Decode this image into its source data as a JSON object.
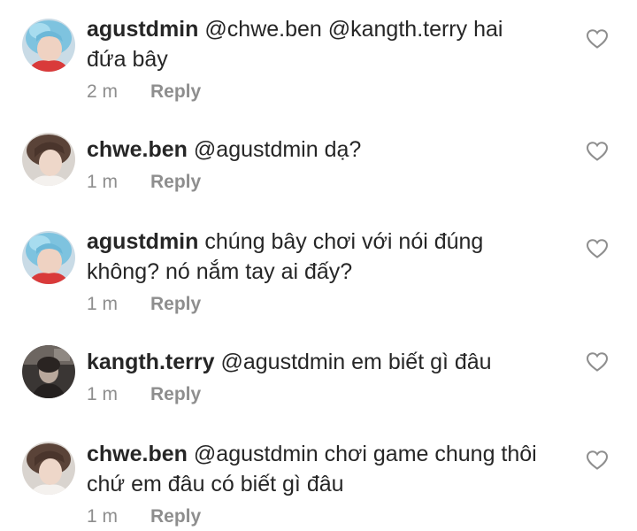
{
  "comments": [
    {
      "username": "agustdmin",
      "text": "@chwe.ben @kangth.terry hai đứa bây",
      "time": "2 m",
      "reply_label": "Reply",
      "avatar": "blue-hair-avatar"
    },
    {
      "username": "chwe.ben",
      "text": "@agustdmin dạ?",
      "time": "1 m",
      "reply_label": "Reply",
      "avatar": "brown-hair-avatar"
    },
    {
      "username": "agustdmin",
      "text": "chúng bây chơi với nói đúng không? nó nắm tay ai đấy?",
      "time": "1 m",
      "reply_label": "Reply",
      "avatar": "blue-hair-avatar"
    },
    {
      "username": "kangth.terry",
      "text": "@agustdmin em biết gì đâu",
      "time": "1 m",
      "reply_label": "Reply",
      "avatar": "dark-room-avatar"
    },
    {
      "username": "chwe.ben",
      "text": "@agustdmin chơi game chung thôi chứ em đâu có biết gì đâu",
      "time": "1 m",
      "reply_label": "Reply",
      "avatar": "brown-hair-avatar"
    }
  ],
  "colors": {
    "text": "#262626",
    "muted": "#8e8e8e",
    "heart": "#8e8e8e"
  }
}
